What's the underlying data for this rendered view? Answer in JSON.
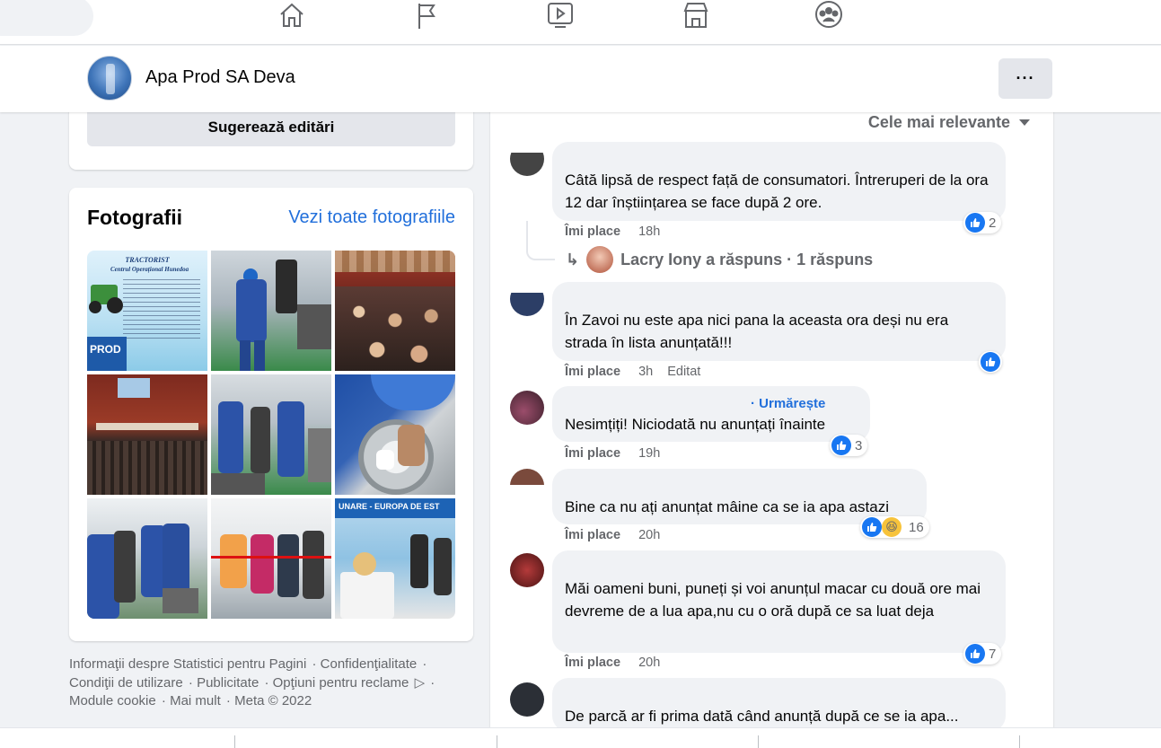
{
  "nav": {
    "icons": [
      "home-icon",
      "flag-icon",
      "video-icon",
      "marketplace-icon",
      "groups-icon"
    ]
  },
  "page": {
    "name": "Apa Prod SA Deva",
    "more_label": "···"
  },
  "sidebar": {
    "suggest_label": "Sugerează editări",
    "photos_title": "Fotografii",
    "photos_link": "Vezi toate fotografiile",
    "photo1_title": "TRACTORIST",
    "photo1_subtitle": "Centrul Operațional Hunedoa",
    "photo1_brand": "PROD",
    "photo9_banner": "UNARE - EUROPA DE EST"
  },
  "footer": {
    "links": [
      "Informaţii despre Statistici pentru Pagini",
      "Confidenţialitate",
      "Condiţii de utilizare",
      "Publicitate",
      "Opţiuni pentru reclame",
      "Module cookie",
      "Mai mult",
      "Meta © 2022"
    ]
  },
  "comments": {
    "sort_label": "Cele mai relevante",
    "like_label": "Îmi place",
    "edited_label": "Editat",
    "follow_label": "· Urmărește",
    "items": [
      {
        "text": "Câtă lipsă de respect față de consumatori. Întreruperi de la ora 12 dar înștiințarea se face după 2 ore.",
        "time": "18h",
        "reactions": "2"
      },
      {
        "text": "În Zavoi nu este apa nici pana la aceasta ora deși nu era strada în lista anunțată!!!",
        "time": "3h",
        "reactions": ""
      },
      {
        "text": "Nesimțiți! Niciodată nu anunțați înainte",
        "time": "19h",
        "reactions": "3"
      },
      {
        "text": "Bine ca nu ați anunțat mâine ca se ia apa astazi",
        "time": "20h",
        "reactions": "16"
      },
      {
        "text": "Măi oameni buni, puneți și voi anunțul macar cu două ore mai devreme de a lua apa,nu cu o oră după ce sa luat deja",
        "time": "20h",
        "reactions": "7"
      },
      {
        "text": "De parcă ar fi prima dată când anunță după ce se ia apa...",
        "time": "",
        "reactions": ""
      }
    ],
    "reply": "Lacry Iony a răspuns · 1 răspuns"
  },
  "colors": {
    "accent": "#1877f2",
    "link": "#216fdb",
    "bubble": "#f0f2f5",
    "secondary_text": "#65676b"
  }
}
